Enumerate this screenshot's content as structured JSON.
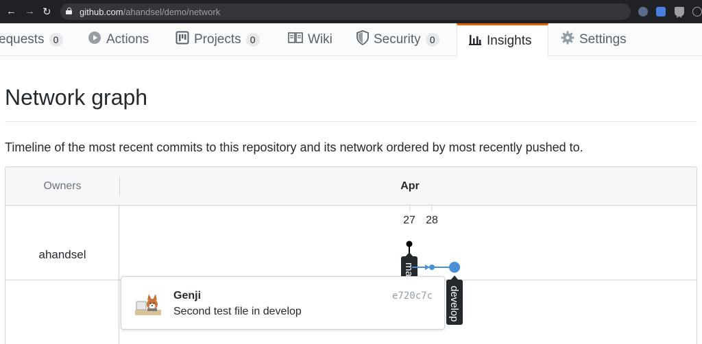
{
  "browser": {
    "url_host": "github.com",
    "url_path": "/ahandsel/demo/network",
    "back_icon": "←",
    "forward_icon": "→",
    "reload_icon": "↻",
    "star_icon": "☆"
  },
  "tabs": [
    {
      "label": "equests",
      "count": "0",
      "icon": "pull-request-icon"
    },
    {
      "label": "Actions",
      "icon": "play-icon"
    },
    {
      "label": "Projects",
      "count": "0",
      "icon": "project-icon"
    },
    {
      "label": "Wiki",
      "icon": "book-icon"
    },
    {
      "label": "Security",
      "count": "0",
      "icon": "shield-icon"
    },
    {
      "label": "Insights",
      "icon": "graph-icon",
      "active": true
    },
    {
      "label": "Settings",
      "icon": "gear-icon"
    }
  ],
  "page": {
    "title": "Network graph",
    "description": "Timeline of the most recent commits to this repository and its network ordered by most recently pushed to."
  },
  "graph": {
    "owners_header": "Owners",
    "month": "Apr",
    "days": [
      "27",
      "28"
    ],
    "owner": "ahandsel",
    "branches": [
      "master",
      "develop"
    ],
    "master_label_visible": "ma"
  },
  "commit": {
    "author": "Genji",
    "sha": "e720c7c",
    "message": "Second test file in develop"
  },
  "colors": {
    "accent_orange": "#e36209",
    "branch_blue": "#4a90d9",
    "master_black": "#000000"
  }
}
